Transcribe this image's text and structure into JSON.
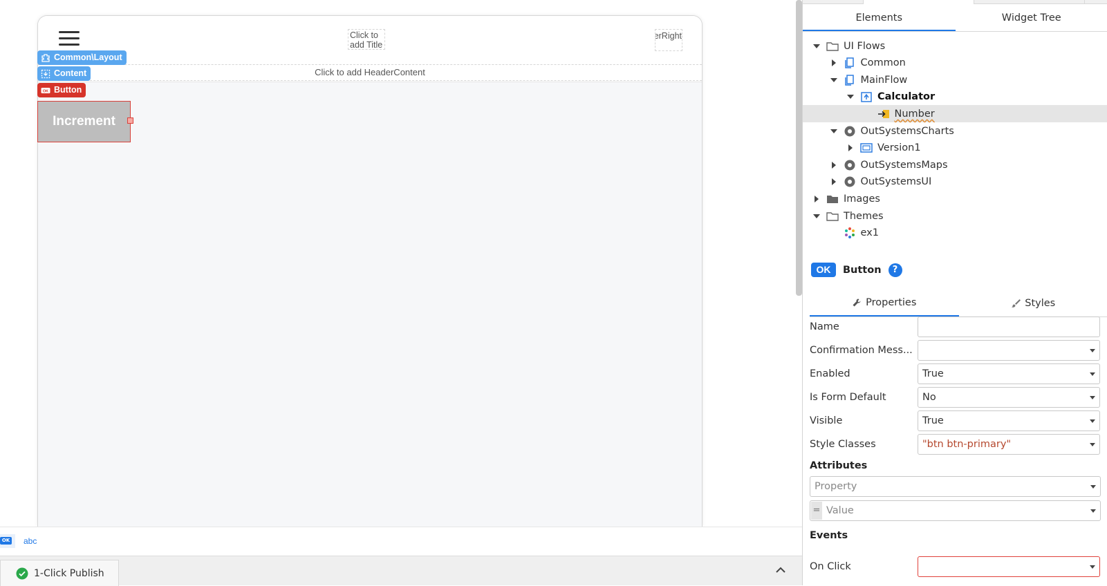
{
  "canvas": {
    "title_placeholder": "Click to add Title",
    "header_right_placeholder": "Click to add HeaderRight",
    "header_content_placeholder": "Click to add HeaderContent",
    "tags": {
      "layout": "Common\\Layout",
      "content": "Content",
      "button": "Button"
    },
    "increment_label": "Increment"
  },
  "bottom": {
    "widget_ok": "OK",
    "widget_text": "abc",
    "publish_label": "1-Click Publish"
  },
  "panel": {
    "tabs": [
      "Elements",
      "Widget Tree"
    ],
    "tree": [
      {
        "label": "UI Flows",
        "depth": 0,
        "caret": "down",
        "icon": "folder-open"
      },
      {
        "label": "Common",
        "depth": 1,
        "caret": "right",
        "icon": "flow"
      },
      {
        "label": "MainFlow",
        "depth": 1,
        "caret": "down",
        "icon": "flow"
      },
      {
        "label": "Calculator",
        "depth": 2,
        "caret": "down",
        "icon": "screen"
      },
      {
        "label": "Number",
        "depth": 3,
        "caret": "none",
        "icon": "input-param"
      },
      {
        "label": "OutSystemsCharts",
        "depth": 1,
        "caret": "down",
        "icon": "module"
      },
      {
        "label": "Version1",
        "depth": 2,
        "caret": "right",
        "icon": "block"
      },
      {
        "label": "OutSystemsMaps",
        "depth": 1,
        "caret": "right",
        "icon": "module"
      },
      {
        "label": "OutSystemsUI",
        "depth": 1,
        "caret": "right",
        "icon": "module"
      },
      {
        "label": "Images",
        "depth": 0,
        "caret": "right",
        "icon": "folder"
      },
      {
        "label": "Themes",
        "depth": 0,
        "caret": "down",
        "icon": "folder-open"
      },
      {
        "label": "ex1",
        "depth": 1,
        "caret": "none",
        "icon": "theme"
      }
    ],
    "selected_widget": {
      "badge": "OK",
      "title": "Button",
      "help": "?"
    },
    "prop_tabs": [
      "Properties",
      "Styles"
    ],
    "properties": [
      {
        "label": "Name",
        "value": "",
        "dropdown": false
      },
      {
        "label": "Confirmation Mess...",
        "value": "",
        "dropdown": true
      },
      {
        "label": "Enabled",
        "value": "True",
        "dropdown": true
      },
      {
        "label": "Is Form Default",
        "value": "No",
        "dropdown": true
      },
      {
        "label": "Visible",
        "value": "True",
        "dropdown": true
      },
      {
        "label": "Style Classes",
        "value": "\"btn btn-primary\"",
        "dropdown": true
      }
    ],
    "attributes_title": "Attributes",
    "attribute_property_placeholder": "Property",
    "attribute_equals": "=",
    "attribute_value_placeholder": "Value",
    "events_title": "Events",
    "on_click_label": "On Click",
    "on_click_value": "",
    "colors": {
      "accent": "#1f78e6",
      "selection_tag": "#d6342a",
      "container_tag": "#5aa7ef"
    }
  }
}
